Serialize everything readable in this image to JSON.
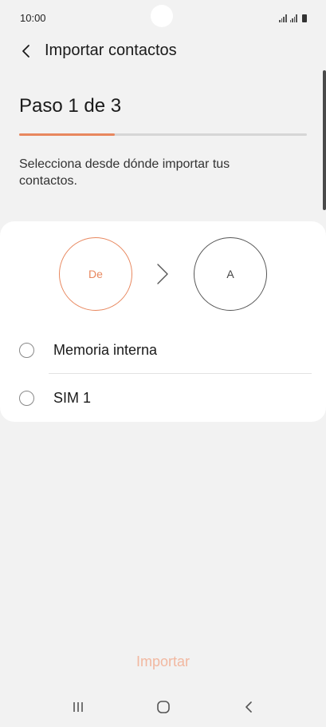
{
  "status_bar": {
    "time": "10:00"
  },
  "header": {
    "title": "Importar contactos"
  },
  "step": {
    "title": "Paso 1 de 3",
    "progress": 0.333
  },
  "instructions": "Selecciona desde dónde importar tus contactos.",
  "card": {
    "from_label": "De",
    "to_label": "A",
    "options": [
      {
        "label": "Memoria interna",
        "selected": false
      },
      {
        "label": "SIM 1",
        "selected": false
      }
    ]
  },
  "footer": {
    "import_label": "Importar"
  },
  "colors": {
    "accent": "#e8875e",
    "import_disabled": "#f2b8a0",
    "background": "#f2f2f2"
  },
  "icons": {
    "back": "chevron-left-icon",
    "arrow": "chevron-right-icon",
    "nav_recent": "recent-apps-icon",
    "nav_home": "home-icon",
    "nav_back": "nav-back-icon"
  }
}
